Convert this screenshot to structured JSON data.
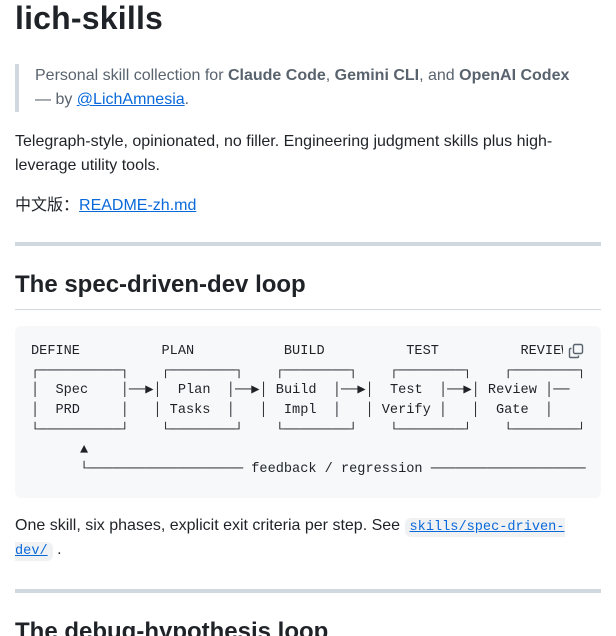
{
  "title": "lich-skills",
  "intro": {
    "prefix": "Personal skill collection for ",
    "tool1": "Claude Code",
    "sep1": ", ",
    "tool2": "Gemini CLI",
    "sep2": ", and ",
    "tool3": "OpenAI Codex",
    "by": " — by ",
    "author": "@LichAmnesia",
    "end": "."
  },
  "tagline": "Telegraph-style, opinionated, no filler. Engineering judgment skills plus high-leverage utility tools.",
  "zh": {
    "label": "中文版：",
    "link": "README-zh.md"
  },
  "section1": {
    "heading": "The spec-driven-dev loop",
    "diagram": "DEFINE          PLAN           BUILD          TEST          REVIEW\n┌──────────┐    ┌────────┐    ┌────────┐    ┌────────┐    ┌────────┐\n│  Spec    │──▶│  Plan  │──▶│ Build  │──▶│  Test  │──▶│ Review │──\n│  PRD     │   │ Tasks  │   │  Impl  │   │ Verify │   │  Gate  │\n└──────────┘    └────────┘    └────────┘    └────────┘    └────────┘\n      ▲\n      └─────────────────── feedback / regression ───────────────────",
    "desc_prefix": "One skill, six phases, explicit exit criteria per step. See ",
    "desc_code": "skills/spec-driven-dev/",
    "desc_suffix": " ."
  },
  "section2": {
    "heading": "The debug-hypothesis loop"
  }
}
